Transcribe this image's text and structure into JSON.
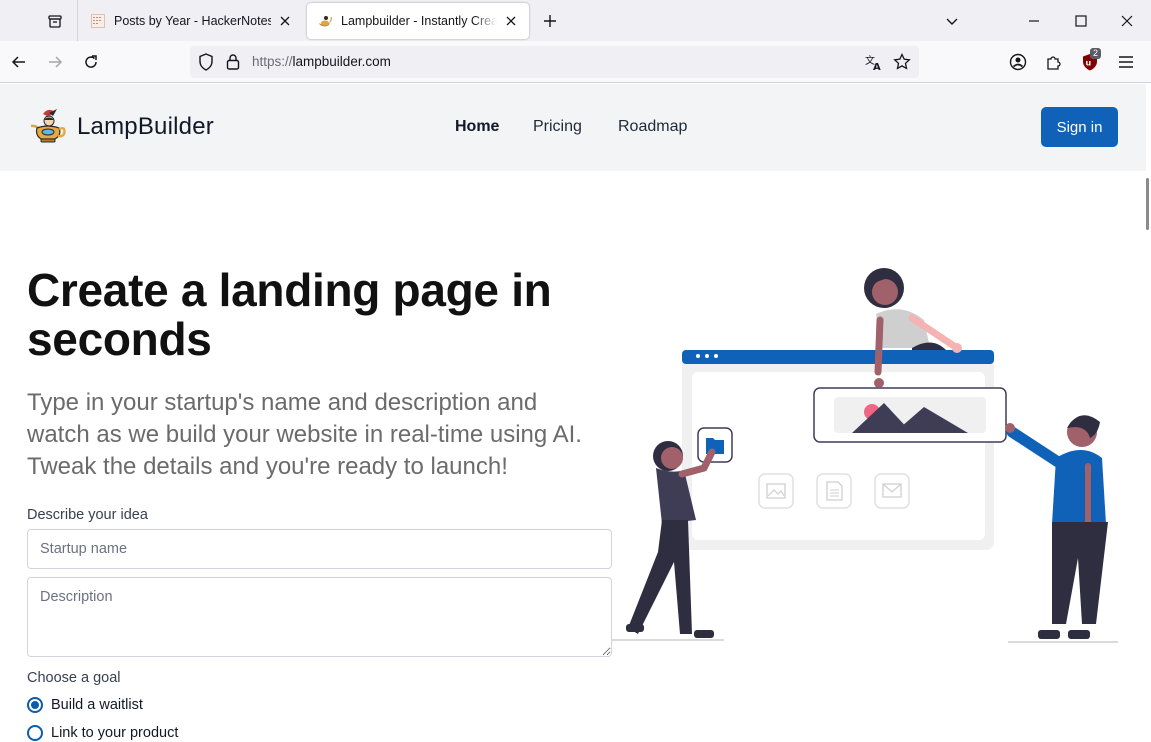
{
  "browser": {
    "tabs": [
      {
        "title": "Posts by Year - HackerNotes",
        "active": false
      },
      {
        "title": "Lampbuilder - Instantly Create Startup Landing Pages",
        "active": true
      }
    ],
    "url_scheme": "https://",
    "url_host": "lampbuilder.com",
    "extension_badge": "2",
    "accent": "#1061b8"
  },
  "site": {
    "brand": "LampBuilder",
    "nav": [
      "Home",
      "Pricing",
      "Roadmap"
    ],
    "signin_label": "Sign in"
  },
  "hero": {
    "title": "Create a landing page in seconds",
    "subtitle": "Type in your startup's name and description and watch as we build your website in real-time using AI. Tweak the details and you're ready to launch!"
  },
  "form": {
    "idea_label": "Describe your idea",
    "name_placeholder": "Startup name",
    "description_placeholder": "Description",
    "goal_label": "Choose a goal",
    "goals": [
      {
        "label": "Build a waitlist",
        "selected": true
      },
      {
        "label": "Link to your product",
        "selected": false
      }
    ]
  }
}
